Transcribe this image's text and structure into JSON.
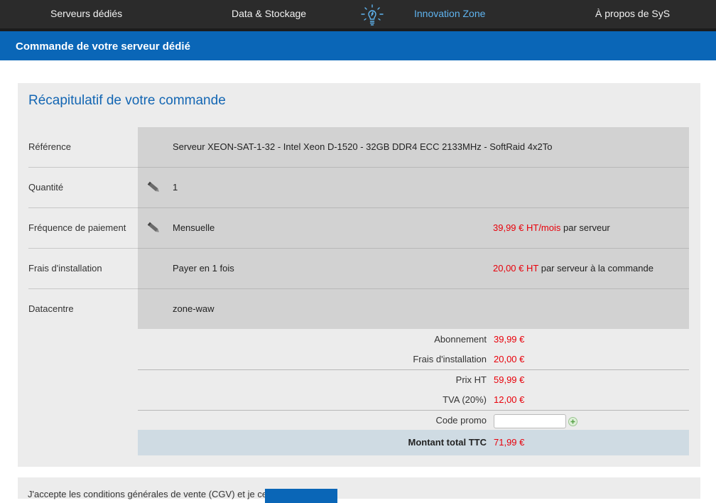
{
  "nav": {
    "items": [
      {
        "label": "Serveurs dédiés"
      },
      {
        "label": "Data & Stockage"
      },
      {
        "label": "Innovation Zone"
      },
      {
        "label": "À propos de SyS"
      }
    ],
    "active": "Innovation Zone",
    "active_color": "#5fb4f0",
    "bulb_icon": "lightbulb-icon"
  },
  "header": {
    "title": "Commande de votre serveur dédié",
    "bar_color": "#0a66b7"
  },
  "summary": {
    "title": "Récapitulatif de votre commande",
    "rows": [
      {
        "label": "Référence",
        "value": "Serveur XEON-SAT-1-32 - Intel Xeon D-1520 - 32GB DDR4 ECC 2133MHz - SoftRaid 4x2To",
        "editable": false
      },
      {
        "label": "Quantité",
        "value": "1",
        "editable": true
      },
      {
        "label": "Fréquence de paiement",
        "value": "Mensuelle",
        "editable": true,
        "price": "39,99 € HT/mois",
        "price_suffix": "par serveur"
      },
      {
        "label": "Frais d'installation",
        "value": "Payer en 1 fois",
        "editable": false,
        "price": "20,00 € HT",
        "price_suffix": "par serveur à la commande"
      },
      {
        "label": "Datacentre",
        "value": "zone-waw",
        "editable": false
      }
    ],
    "edit_icon": "pencil-icon"
  },
  "totals": {
    "abonnement": {
      "label": "Abonnement",
      "value": "39,99 €"
    },
    "frais": {
      "label": "Frais d'installation",
      "value": "20,00 €"
    },
    "prix_ht": {
      "label": "Prix HT",
      "value": "59,99 €"
    },
    "tva": {
      "label": "TVA (20%)",
      "value": "12,00 €"
    },
    "promo": {
      "label": "Code promo",
      "value": "",
      "add_icon": "plus-circle-icon"
    },
    "total": {
      "label": "Montant total TTC",
      "value": "71,99 €"
    },
    "accent_color": "#e8000a"
  },
  "footer_panel": {
    "text": "J'accepte les conditions générales de vente (CGV) et je certifie..."
  }
}
